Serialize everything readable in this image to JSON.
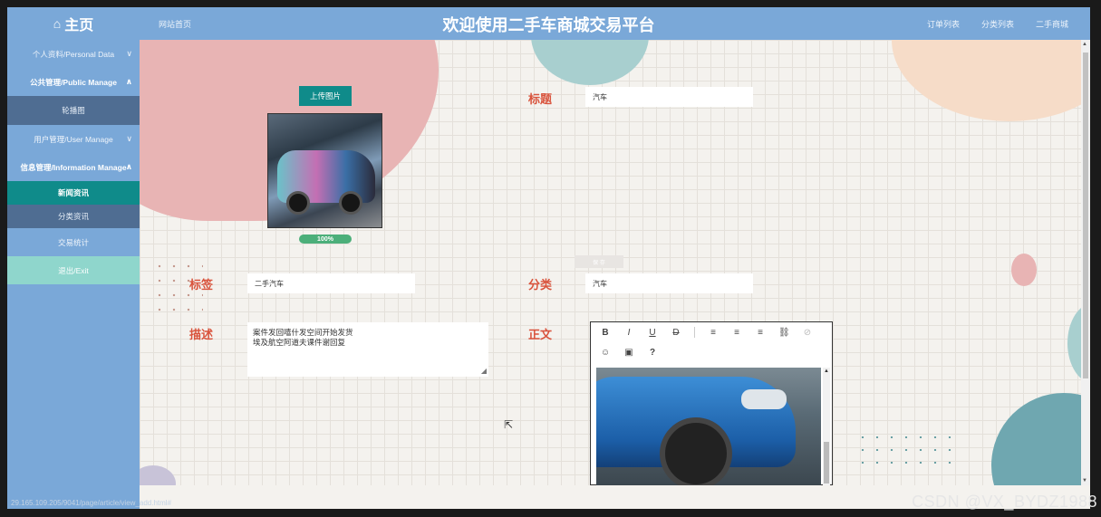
{
  "header": {
    "home_label": "主页",
    "site_link": "网站首页",
    "title": "欢迎使用二手车商城交易平台",
    "links": [
      "订单列表",
      "分类列表",
      "二手商城"
    ]
  },
  "sidebar": {
    "items": [
      {
        "label": "个人资料/Personal Data",
        "chevron": "∨"
      },
      {
        "label": "公共管理/Public Manage",
        "chevron": "∧"
      },
      {
        "label": "轮播图"
      },
      {
        "label": "用户管理/User Manage",
        "chevron": "∨"
      },
      {
        "label": "信息管理/Information Manage",
        "chevron": "∧"
      },
      {
        "label": "新闻资讯"
      },
      {
        "label": "分类资讯"
      },
      {
        "label": "交易统计"
      },
      {
        "label": "退出/Exit"
      }
    ],
    "status_url": "29.165.109.205/9041/page/article/view_add.html#"
  },
  "form": {
    "upload_button": "上传图片",
    "upload_progress": "100%",
    "title_label": "标题",
    "title_value": "汽车",
    "tag_label": "标签",
    "tag_value": "二手汽车",
    "category_label": "分类",
    "category_value": "汽车",
    "desc_label": "描述",
    "desc_value": "案件发回嘻什发空间开始发货\n埃及航空阿道夫课件谢回复",
    "body_label": "正文",
    "ghost_button": "保 存"
  },
  "editor": {
    "toolbar_row1": [
      "B",
      "I",
      "U",
      "D",
      "≡",
      "≡",
      "≡",
      "⛓",
      "⊘"
    ],
    "toolbar_row2": [
      "☺",
      "▣",
      "?"
    ]
  },
  "watermark": "CSDN @VX_BYDZ1988",
  "colors": {
    "header": "#7aa8d8",
    "accent": "#0f8b8a",
    "label": "#d9533c",
    "exit": "#8fd6cc"
  }
}
